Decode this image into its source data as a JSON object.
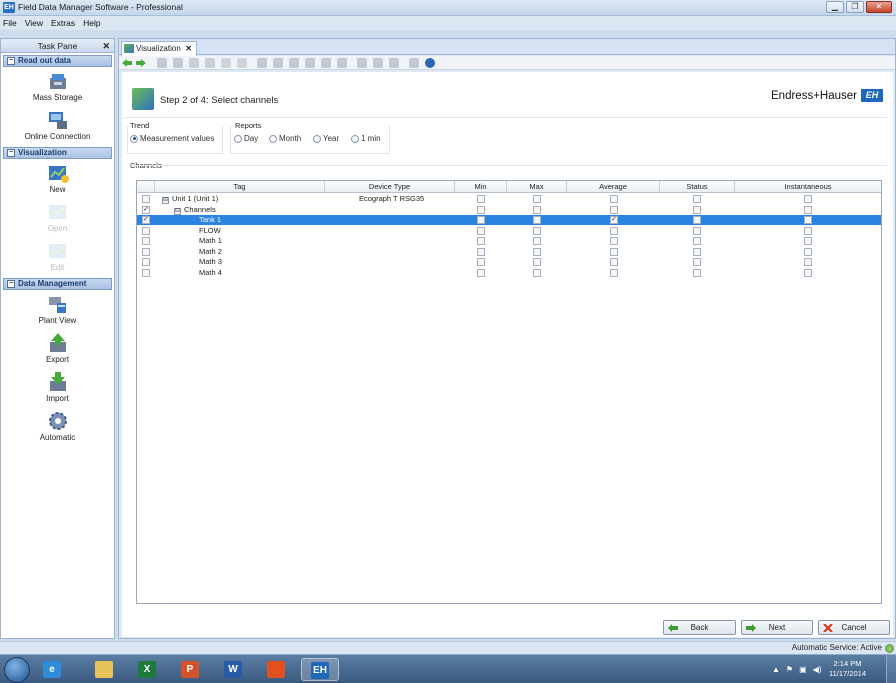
{
  "window": {
    "title": "Field Data Manager Software - Professional",
    "app_icon": "EH",
    "minimize": "▁",
    "maximize": "❐",
    "close": "✕"
  },
  "menu": [
    "File",
    "View",
    "Extras",
    "Help"
  ],
  "taskpane": {
    "title": "Task Pane",
    "close": "✕",
    "sections": [
      {
        "label": "Read out data",
        "collapse": "−",
        "items": [
          {
            "label": "Mass Storage",
            "icon": "mass-storage-icon"
          },
          {
            "label": "Online Connection",
            "icon": "online-connection-icon"
          }
        ]
      },
      {
        "label": "Visualization",
        "collapse": "−",
        "items": [
          {
            "label": "New",
            "icon": "new-visualization-icon"
          },
          {
            "label": "Open",
            "icon": "open-visualization-icon"
          },
          {
            "label": "Edit",
            "icon": "edit-visualization-icon"
          }
        ]
      },
      {
        "label": "Data Management",
        "collapse": "−",
        "items": [
          {
            "label": "Plant View",
            "icon": "plant-view-icon"
          },
          {
            "label": "Export",
            "icon": "export-icon"
          },
          {
            "label": "Import",
            "icon": "import-icon"
          },
          {
            "label": "Automatic",
            "icon": "automatic-gear-icon"
          }
        ]
      }
    ]
  },
  "doc_tab": {
    "label": "Visualization",
    "close": "✕"
  },
  "wizard": {
    "step_title": "Step 2 of 4: Select channels",
    "brand_text": "Endress+Hauser",
    "brand_logo": "EH",
    "trend": {
      "label": "Trend",
      "options": [
        {
          "label": "Measurement values",
          "selected": true
        }
      ]
    },
    "reports": {
      "label": "Reports",
      "options": [
        {
          "label": "Day",
          "selected": false
        },
        {
          "label": "Month",
          "selected": false
        },
        {
          "label": "Year",
          "selected": false
        },
        {
          "label": "1 min",
          "selected": false
        }
      ]
    },
    "channels_label": "Channels"
  },
  "grid": {
    "columns": [
      "Tag",
      "Device Type",
      "Min",
      "Max",
      "Average",
      "Status",
      "Instantaneous"
    ],
    "rows": [
      {
        "check": false,
        "expander": "⊟",
        "tag": "Unit 1 (Unit 1)",
        "device": "Ecograph T RSG35",
        "min": false,
        "max": false,
        "avg": false,
        "status": false,
        "inst": false,
        "level": 0
      },
      {
        "check": true,
        "expander": "⊟",
        "tag": "Channels",
        "device": "",
        "min": false,
        "max": false,
        "avg": false,
        "status": false,
        "inst": false,
        "level": 1
      },
      {
        "check": true,
        "expander": "",
        "tag": "Tank 1",
        "device": "",
        "min": false,
        "max": false,
        "avg": true,
        "status": false,
        "inst": false,
        "level": 2,
        "selected": true
      },
      {
        "check": false,
        "expander": "",
        "tag": "FLOW",
        "device": "",
        "min": false,
        "max": false,
        "avg": false,
        "status": false,
        "inst": false,
        "level": 2
      },
      {
        "check": false,
        "expander": "",
        "tag": "Math 1",
        "device": "",
        "min": false,
        "max": false,
        "avg": false,
        "status": false,
        "inst": false,
        "level": 2
      },
      {
        "check": false,
        "expander": "",
        "tag": "Math 2",
        "device": "",
        "min": false,
        "max": false,
        "avg": false,
        "status": false,
        "inst": false,
        "level": 2
      },
      {
        "check": false,
        "expander": "",
        "tag": "Math 3",
        "device": "",
        "min": false,
        "max": false,
        "avg": false,
        "status": false,
        "inst": false,
        "level": 2
      },
      {
        "check": false,
        "expander": "",
        "tag": "Math 4",
        "device": "",
        "min": false,
        "max": false,
        "avg": false,
        "status": false,
        "inst": false,
        "level": 2
      }
    ]
  },
  "buttons": {
    "back": "Back",
    "next": "Next",
    "cancel": "Cancel"
  },
  "status": {
    "text": "Automatic Service: Active"
  },
  "taskbar": {
    "apps": [
      {
        "name": "internet-explorer-icon",
        "glyph": "e",
        "color": "#2f8ad8"
      },
      {
        "name": "file-explorer-icon",
        "glyph": "",
        "color": "#e8c35a"
      },
      {
        "name": "excel-icon",
        "glyph": "X",
        "color": "#1e7a3b"
      },
      {
        "name": "powerpoint-icon",
        "glyph": "P",
        "color": "#d2522b"
      },
      {
        "name": "word-icon",
        "glyph": "W",
        "color": "#2a5ba8"
      },
      {
        "name": "office-icon",
        "glyph": "",
        "color": "#e2501f"
      },
      {
        "name": "field-data-manager-icon",
        "glyph": "EH",
        "color": "#1f67b9"
      }
    ],
    "time": "2:14 PM",
    "date": "11/17/2014"
  },
  "colors": {
    "accent": "#2a83df",
    "brand": "#1f67b9",
    "section": "#1c3d73"
  }
}
